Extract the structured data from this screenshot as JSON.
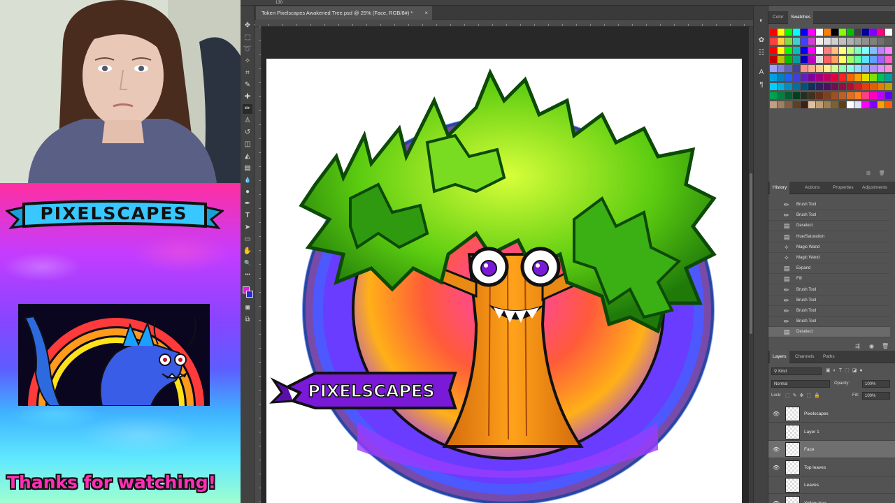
{
  "stream_overlay": {
    "banner_text": "PIXELSCAPES",
    "thanks_text": "Thanks for watching!"
  },
  "photoshop": {
    "ruler_readout": "130",
    "document_tab": {
      "title": "Token Pixelscapes Awakened Tree.psd @ 25% (Face, RGB/8#) *",
      "close": "×"
    },
    "artwork": {
      "label": "PIXELSCAPES"
    },
    "toolbar": {
      "tools": [
        {
          "name": "move-tool-icon",
          "glyph": "✥"
        },
        {
          "name": "marquee-tool-icon",
          "glyph": "⬚"
        },
        {
          "name": "lasso-tool-icon",
          "glyph": "➰"
        },
        {
          "name": "magic-wand-tool-icon",
          "glyph": "✧"
        },
        {
          "name": "crop-tool-icon",
          "glyph": "⌗"
        },
        {
          "name": "eyedropper-tool-icon",
          "glyph": "✎"
        },
        {
          "name": "healing-brush-tool-icon",
          "glyph": "✚"
        },
        {
          "name": "brush-tool-icon",
          "glyph": "✏"
        },
        {
          "name": "clone-stamp-tool-icon",
          "glyph": "♙"
        },
        {
          "name": "history-brush-tool-icon",
          "glyph": "↺"
        },
        {
          "name": "eraser-tool-icon",
          "glyph": "◫"
        },
        {
          "name": "paint-bucket-tool-icon",
          "glyph": "◭"
        },
        {
          "name": "gradient-tool-icon",
          "glyph": "▤"
        },
        {
          "name": "blur-tool-icon",
          "glyph": "💧"
        },
        {
          "name": "dodge-tool-icon",
          "glyph": "●"
        },
        {
          "name": "pen-tool-icon",
          "glyph": "✒"
        },
        {
          "name": "type-tool-icon",
          "glyph": "T"
        },
        {
          "name": "path-selection-tool-icon",
          "glyph": "➤"
        },
        {
          "name": "shape-tool-icon",
          "glyph": "▭"
        },
        {
          "name": "hand-tool-icon",
          "glyph": "✋"
        },
        {
          "name": "zoom-tool-icon",
          "glyph": "🔍"
        },
        {
          "name": "more-tools-icon",
          "glyph": "•••"
        }
      ],
      "foreground_color": "#e01ee0",
      "background_color": "#2a2ad8"
    },
    "icon_strip": [
      {
        "name": "color-panel-icon",
        "glyph": "◐"
      },
      {
        "name": "brush-settings-icon",
        "glyph": "✿"
      },
      {
        "name": "adjustments-icon",
        "glyph": "☷"
      },
      {
        "name": "character-icon",
        "glyph": "A"
      },
      {
        "name": "paragraph-icon",
        "glyph": "¶"
      }
    ],
    "color_panel": {
      "tabs": [
        "Color",
        "Swatches"
      ],
      "active_tab": "Swatches",
      "swatches": [
        "#ff0000",
        "#ffff00",
        "#00ff00",
        "#00ffff",
        "#0000ff",
        "#ff00ff",
        "#ffffff",
        "#ff8000",
        "#000000",
        "#80ff00",
        "#00c000",
        "#404040",
        "#0000a0",
        "#8000ff",
        "#ff0080",
        "#ffffff",
        "#ff4040",
        "#ffd040",
        "#80e040",
        "#40d0d0",
        "#4040ff",
        "#d040d0",
        "#f0f0f0",
        "#e0e0e0",
        "#d0d0d0",
        "#c0c0c0",
        "#b0b0b0",
        "#a0a0a0",
        "#909090",
        "#808080",
        "#707070",
        "#606060",
        "#ff0000",
        "#ffff00",
        "#00ff00",
        "#00c0c0",
        "#0000ff",
        "#ff00ff",
        "#ffffff",
        "#ff8080",
        "#ffc080",
        "#ffff80",
        "#c0ff80",
        "#80ffc0",
        "#80ffff",
        "#80c0ff",
        "#c080ff",
        "#ff80ff",
        "#c00000",
        "#c0c000",
        "#00c000",
        "#00a0a0",
        "#0000c0",
        "#c000c0",
        "#e0e0e0",
        "#ff6060",
        "#ffa060",
        "#ffff60",
        "#a0ff60",
        "#60ffa0",
        "#60e0ff",
        "#60a0ff",
        "#a060ff",
        "#ff60c0",
        "#a0a0ff",
        "#8080e0",
        "#6060c0",
        "#4040a0",
        "#ff9090",
        "#ffb090",
        "#ffd090",
        "#fff090",
        "#d0ff90",
        "#90ffb0",
        "#90ffe0",
        "#90e0ff",
        "#90b0ff",
        "#b090ff",
        "#e090ff",
        "#ff90d0",
        "#00a0e0",
        "#0080c0",
        "#2060ff",
        "#4040e0",
        "#6020c0",
        "#8000a0",
        "#a00080",
        "#c00060",
        "#e00040",
        "#ff2020",
        "#ff6000",
        "#ffa000",
        "#e0e000",
        "#80e000",
        "#00c060",
        "#00a0a0",
        "#00d0ff",
        "#00b0e0",
        "#0090c0",
        "#0070a0",
        "#005080",
        "#103060",
        "#302060",
        "#501060",
        "#701050",
        "#901040",
        "#b01030",
        "#d02020",
        "#e04010",
        "#e06000",
        "#e08000",
        "#c0a000",
        "#00a050",
        "#008040",
        "#006030",
        "#004020",
        "#203020",
        "#403020",
        "#603020",
        "#804020",
        "#a05020",
        "#c06020",
        "#e07020",
        "#ff8020",
        "#ff4080",
        "#ff00c0",
        "#c000ff",
        "#6000ff",
        "#c0a080",
        "#a08060",
        "#806040",
        "#604020",
        "#402010",
        "#e0c0a0",
        "#c0a070",
        "#a08050",
        "#806030",
        "#604010",
        "#ffffff",
        "#e0e0ff",
        "#ff00ff",
        "#8000ff",
        "#ffa000",
        "#ff6000"
      ]
    },
    "history_panel": {
      "tabs": [
        "History",
        "Actions",
        "Properties",
        "Adjustments"
      ],
      "active_tab": "History",
      "items": [
        {
          "label": "Brush Tool",
          "icon": "brush-icon",
          "glyph": "✏"
        },
        {
          "label": "Brush Tool",
          "icon": "brush-icon",
          "glyph": "✏"
        },
        {
          "label": "Deselect",
          "icon": "document-icon",
          "glyph": "▤"
        },
        {
          "label": "Hue/Saturation",
          "icon": "document-icon",
          "glyph": "▤"
        },
        {
          "label": "Magic Wand",
          "icon": "magic-wand-icon",
          "glyph": "✧"
        },
        {
          "label": "Magic Wand",
          "icon": "magic-wand-icon",
          "glyph": "✧"
        },
        {
          "label": "Expand",
          "icon": "document-icon",
          "glyph": "▤"
        },
        {
          "label": "Fill",
          "icon": "document-icon",
          "glyph": "▤"
        },
        {
          "label": "Brush Tool",
          "icon": "brush-icon",
          "glyph": "✏"
        },
        {
          "label": "Brush Tool",
          "icon": "brush-icon",
          "glyph": "✏"
        },
        {
          "label": "Brush Tool",
          "icon": "brush-icon",
          "glyph": "✏"
        },
        {
          "label": "Brush Tool",
          "icon": "brush-icon",
          "glyph": "✏"
        },
        {
          "label": "Deselect",
          "icon": "document-icon",
          "glyph": "▤"
        }
      ],
      "selected_index": 12
    },
    "layers_panel": {
      "tabs": [
        "Layers",
        "Channels",
        "Paths"
      ],
      "active_tab": "Layers",
      "filter_label": "Kind",
      "blend_mode": "Normal",
      "opacity_label": "Opacity:",
      "opacity_value": "100%",
      "lock_label": "Lock:",
      "fill_label": "Fill:",
      "fill_value": "100%",
      "layers": [
        {
          "name": "Pixelscapes",
          "visible": true
        },
        {
          "name": "Layer 1",
          "visible": false
        },
        {
          "name": "Face",
          "visible": true
        },
        {
          "name": "Top leaves",
          "visible": true
        },
        {
          "name": "Leaves",
          "visible": false
        },
        {
          "name": "Yellow tree",
          "visible": true
        }
      ],
      "selected_index": 2
    }
  }
}
